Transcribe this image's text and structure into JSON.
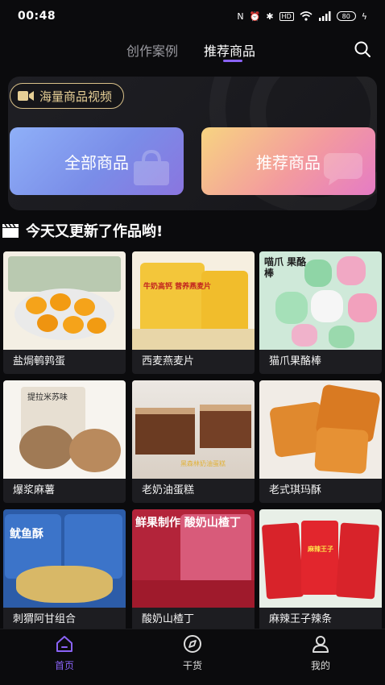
{
  "status_bar": {
    "time": "00:48",
    "battery": "80"
  },
  "top_tabs": [
    {
      "label": "创作案例",
      "active": false
    },
    {
      "label": "推荐商品",
      "active": true
    }
  ],
  "banner": {
    "pill_label": "海量商品视频",
    "all_products": "全部商品",
    "recommended_products": "推荐商品"
  },
  "section_title": "今天又更新了作品哟!",
  "products": [
    {
      "name": "盐焗鹌鹑蛋",
      "image_text": ""
    },
    {
      "name": "西麦燕麦片",
      "image_text": "牛奶高钙 营养燕麦片"
    },
    {
      "name": "猫爪果酪棒",
      "image_text": "喵爪 果酪棒"
    },
    {
      "name": "爆浆麻薯",
      "image_text": "提拉米苏味"
    },
    {
      "name": "老奶油蛋糕",
      "image_text": "黑森林奶油蛋糕"
    },
    {
      "name": "老式琪玛酥",
      "image_text": ""
    },
    {
      "name": "刺猬阿甘组合",
      "image_text": "鱿鱼酥"
    },
    {
      "name": "酸奶山楂丁",
      "image_text": "鲜果制作 酸奶山楂丁"
    },
    {
      "name": "麻辣王子辣条",
      "image_text": "麻辣王子"
    }
  ],
  "bottom_nav": [
    {
      "label": "首页",
      "icon": "home-icon",
      "active": true
    },
    {
      "label": "干货",
      "icon": "compass-icon",
      "active": false
    },
    {
      "label": "我的",
      "icon": "user-icon",
      "active": false
    }
  ],
  "colors": {
    "accent": "#8a63f6",
    "background": "#0b0b0d",
    "pill_border": "#d8c089"
  }
}
